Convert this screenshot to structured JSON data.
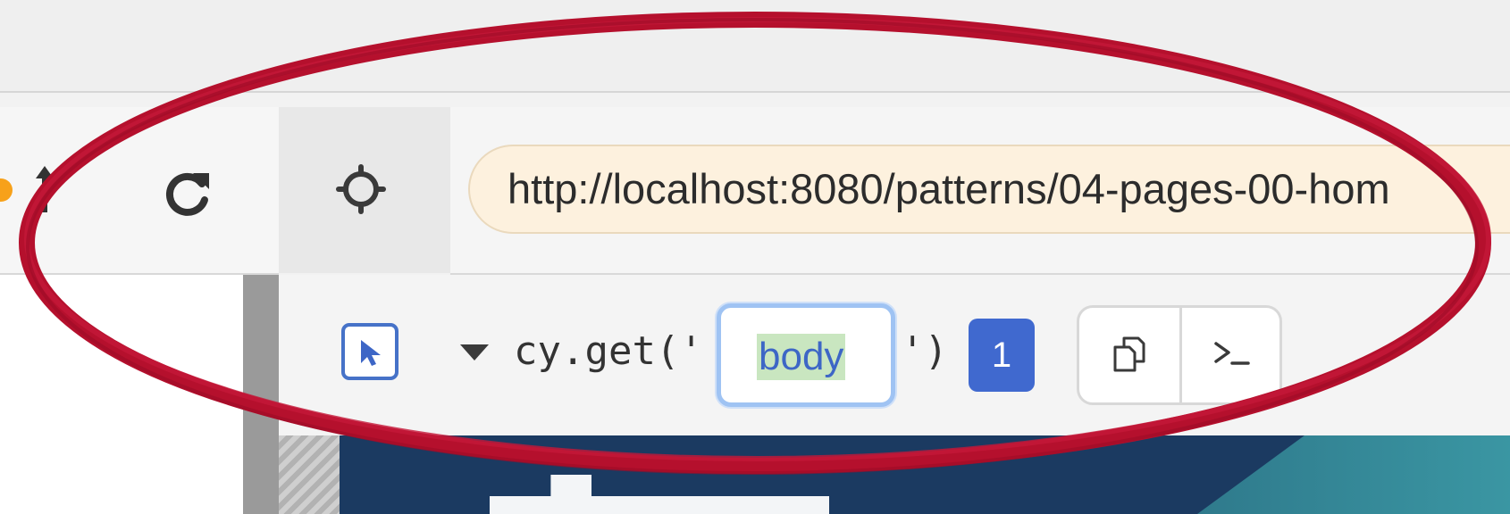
{
  "browser": {
    "url": "http://localhost:8080/patterns/04-pages-00-hom",
    "reload_icon": "reload-icon",
    "target_icon": "crosshair-icon"
  },
  "selector_playground": {
    "code_prefix": "cy.get('",
    "selector_value": "body",
    "code_suffix": "')",
    "match_count": "1",
    "icons": [
      "selector-pointer-icon",
      "caret-down-icon",
      "copy-icon",
      "console-icon"
    ]
  },
  "annotation": {
    "shape": "hand-drawn ellipse",
    "color": "#b5102d"
  },
  "colors": {
    "accent": "#4069cf",
    "url_bg": "#fdf1de",
    "selector_highlight": "#c9e6c0",
    "preview_bg": "#1b3a61"
  }
}
